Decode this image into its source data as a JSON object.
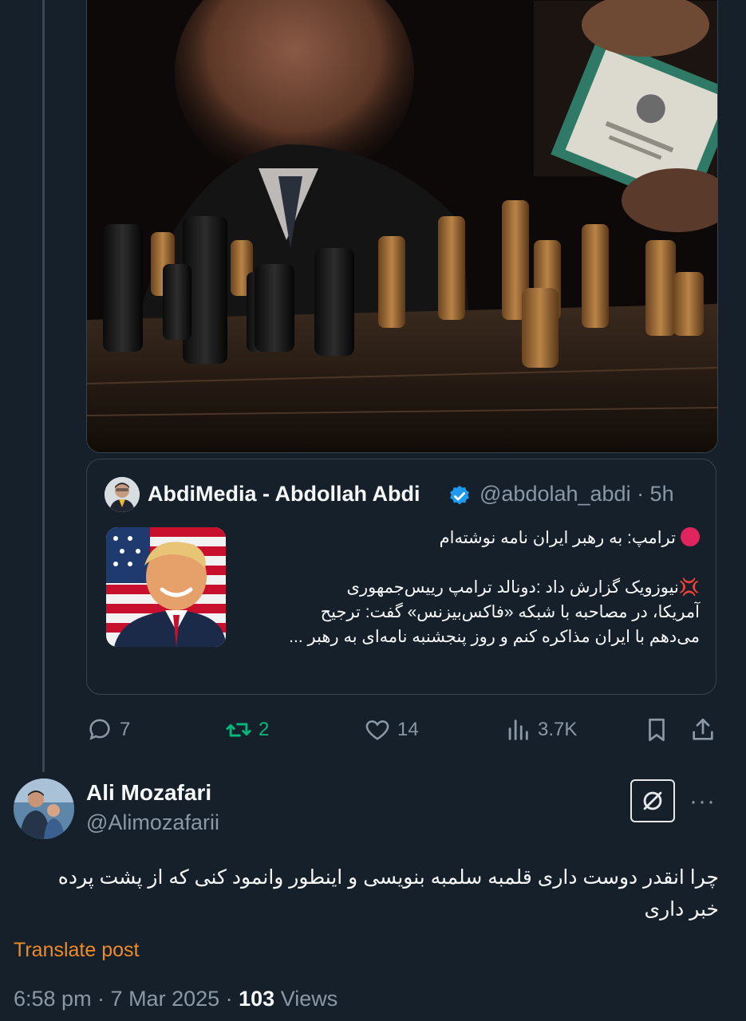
{
  "quoted": {
    "name": "AbdiMedia - Abdollah Abdi",
    "handle_time": "@abdolah_abdi · 5h",
    "lines": [
      "ترامپ: به رهبر ایران نامه نوشته‌ام",
      "",
      "نیوزویک گزارش داد :دونالد ترامپ رییس‌جمهوری",
      "آمریکا، در مصاحبه با شبکه «فاکس‌بیزنس» گفت: ترجیح",
      "می‌دهم با ایران مذاکره کنم و روز پنجشنبه نامه‌ای به رهبر ..."
    ]
  },
  "actions": {
    "replies": "7",
    "reposts": "2",
    "likes": "14",
    "views": "3.7K"
  },
  "reply": {
    "name": "Ali Mozafari",
    "handle": "@Alimozafarii",
    "text": "چرا انقدر دوست داری قلمبه سلمبه بنویسی و اینطور وانمود کنی که از پشت پرده خبر داری",
    "translate_label": "Translate post",
    "timestamp": "6:58 pm · 7 Mar 2025 · ",
    "views_count": "103",
    "views_label": " Views",
    "more_label": "···"
  },
  "colors": {
    "background": "#15202b",
    "border": "#38444d",
    "secondary_text": "#8b98a5",
    "repost_green": "#00ba7c",
    "verified_blue": "#1d9bf0",
    "translate_orange": "#f08a24"
  }
}
